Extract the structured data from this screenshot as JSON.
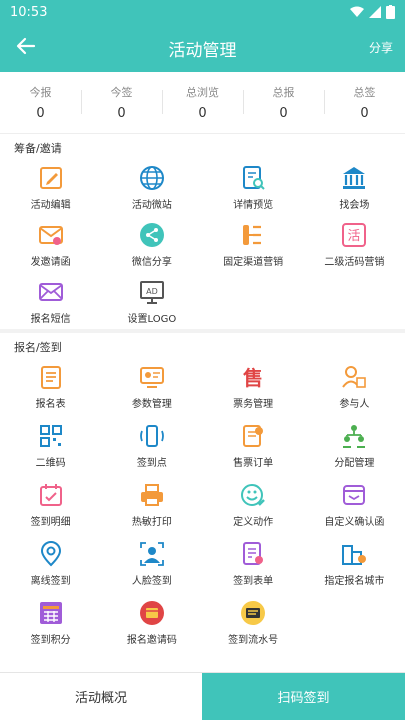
{
  "status_bar": {
    "time": "10:53"
  },
  "header": {
    "title": "活动管理",
    "share": "分享"
  },
  "stats": [
    {
      "label": "今报",
      "value": "0"
    },
    {
      "label": "今签",
      "value": "0"
    },
    {
      "label": "总浏览",
      "value": "0"
    },
    {
      "label": "总报",
      "value": "0"
    },
    {
      "label": "总签",
      "value": "0"
    }
  ],
  "section1": {
    "title": "筹备/邀请",
    "items": [
      {
        "label": "活动编辑",
        "icon": "edit-icon"
      },
      {
        "label": "活动微站",
        "icon": "globe-icon"
      },
      {
        "label": "详情预览",
        "icon": "preview-icon"
      },
      {
        "label": "找会场",
        "icon": "venue-icon"
      },
      {
        "label": "发邀请函",
        "icon": "invite-mail-icon"
      },
      {
        "label": "微信分享",
        "icon": "share-icon"
      },
      {
        "label": "固定渠道营销",
        "icon": "channel-icon"
      },
      {
        "label": "二级活码营销",
        "icon": "qrcode-marketing-icon"
      },
      {
        "label": "报名短信",
        "icon": "sms-icon"
      },
      {
        "label": "设置LOGO",
        "icon": "logo-ad-icon"
      }
    ]
  },
  "section2": {
    "title": "报名/签到",
    "items": [
      {
        "label": "报名表",
        "icon": "form-icon"
      },
      {
        "label": "参数管理",
        "icon": "params-icon"
      },
      {
        "label": "票务管理",
        "icon": "ticket-icon"
      },
      {
        "label": "参与人",
        "icon": "participant-icon"
      },
      {
        "label": "二维码",
        "icon": "qrcode-icon"
      },
      {
        "label": "签到点",
        "icon": "checkin-point-icon"
      },
      {
        "label": "售票订单",
        "icon": "ticket-order-icon"
      },
      {
        "label": "分配管理",
        "icon": "allocation-icon"
      },
      {
        "label": "签到明细",
        "icon": "checkin-detail-icon"
      },
      {
        "label": "热敏打印",
        "icon": "printer-icon"
      },
      {
        "label": "定义动作",
        "icon": "action-icon"
      },
      {
        "label": "自定义确认函",
        "icon": "confirm-letter-icon"
      },
      {
        "label": "离线签到",
        "icon": "offline-checkin-icon"
      },
      {
        "label": "人脸签到",
        "icon": "face-checkin-icon"
      },
      {
        "label": "签到表单",
        "icon": "checkin-form-icon"
      },
      {
        "label": "指定报名城市",
        "icon": "city-icon"
      },
      {
        "label": "签到积分",
        "icon": "points-icon"
      },
      {
        "label": "报名邀请码",
        "icon": "invite-code-icon"
      },
      {
        "label": "签到流水号",
        "icon": "serial-number-icon"
      }
    ]
  },
  "bottom": {
    "left": "活动概况",
    "right": "扫码签到"
  },
  "colors": {
    "primary": "#40c4ba",
    "orange": "#f39a3b",
    "blue": "#1e88c8",
    "pink": "#f0628a",
    "purple": "#a05cd8",
    "red": "#e04545"
  }
}
